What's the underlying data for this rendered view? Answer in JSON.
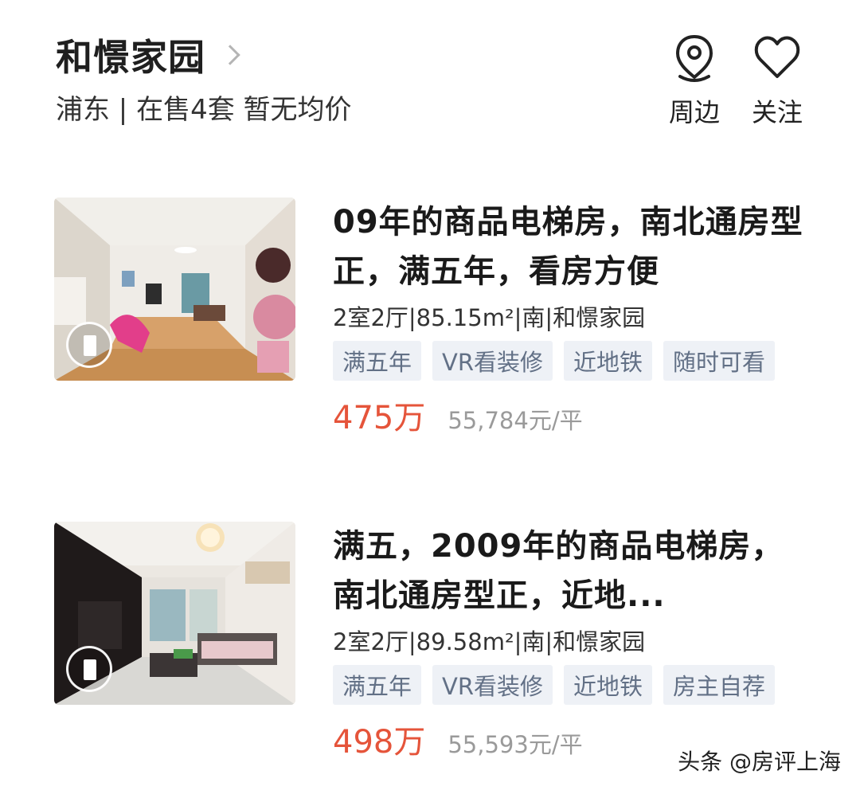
{
  "header": {
    "community_name": "和憬家园",
    "subtitle": "浦东 | 在售4套 暂无均价",
    "actions": [
      {
        "label": "周边",
        "icon": "location-pin-icon"
      },
      {
        "label": "关注",
        "icon": "heart-icon"
      }
    ]
  },
  "listings": [
    {
      "title": "09年的商品电梯房，南北通房型正，满五年，看房方便",
      "meta": "2室2厅|85.15m²|南|和憬家园",
      "tags": [
        "满五年",
        "VR看装修",
        "近地铁",
        "随时可看"
      ],
      "price": "475万",
      "unit_price": "55,784元/平"
    },
    {
      "title": "满五，2009年的商品电梯房，南北通房型正，近地...",
      "meta": "2室2厅|89.58m²|南|和憬家园",
      "tags": [
        "满五年",
        "VR看装修",
        "近地铁",
        "房主自荐"
      ],
      "price": "498万",
      "unit_price": "55,593元/平"
    }
  ],
  "watermark": "头条 @房评上海",
  "colors": {
    "price": "#e5543a",
    "tag_bg": "#eef1f6",
    "tag_text": "#627086"
  }
}
